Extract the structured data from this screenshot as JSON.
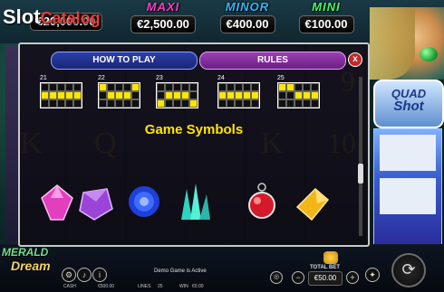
{
  "watermark": {
    "part1": "Slot",
    "part2": "Catalog"
  },
  "jackpots": [
    {
      "name": "",
      "amount": "€20,000.00",
      "color": "#ffffff"
    },
    {
      "name": "MAXI",
      "amount": "€2,500.00",
      "color": "#ff3cc8"
    },
    {
      "name": "MINOR",
      "amount": "€400.00",
      "color": "#35b7ff"
    },
    {
      "name": "MINI",
      "amount": "€100.00",
      "color": "#3cff6a"
    }
  ],
  "panel": {
    "tab_howto": "HOW TO PLAY",
    "tab_rules": "RULES",
    "close_label": "x",
    "heading": "Game Symbols",
    "lines": [
      {
        "num": "21",
        "cells": [
          0,
          0,
          0,
          0,
          0,
          1,
          1,
          1,
          1,
          1,
          0,
          0,
          0,
          0,
          0
        ]
      },
      {
        "num": "22",
        "cells": [
          1,
          0,
          0,
          0,
          1,
          0,
          1,
          1,
          1,
          0,
          0,
          0,
          0,
          0,
          0
        ]
      },
      {
        "num": "23",
        "cells": [
          0,
          0,
          0,
          0,
          0,
          0,
          1,
          1,
          1,
          0,
          1,
          0,
          0,
          0,
          1
        ]
      },
      {
        "num": "24",
        "cells": [
          0,
          0,
          0,
          0,
          0,
          1,
          1,
          1,
          1,
          1,
          0,
          0,
          0,
          0,
          0
        ]
      },
      {
        "num": "25",
        "cells": [
          1,
          1,
          0,
          0,
          0,
          0,
          0,
          1,
          1,
          1,
          0,
          0,
          0,
          0,
          0
        ]
      }
    ]
  },
  "reels": {
    "letters": [
      "K",
      "Q",
      "K",
      "10"
    ],
    "right_number": "9"
  },
  "branding": {
    "logo_line1": "MERALD",
    "logo_line2": "Dream",
    "quad_line1": "QUAD",
    "quad_line2": "Shot"
  },
  "status": {
    "cash_label": "CASH",
    "cash_value": "€500.00",
    "lines_label": "LINES",
    "lines_value": "25",
    "win_label": "WIN",
    "win_value": "€0.00",
    "demo_text": "Demo Game is Active",
    "total_bet_label": "TOTAL BET",
    "total_bet_value": "€50.00"
  },
  "colors": {
    "accent_yellow": "#ffe600",
    "tab_blue": "#2b3fa8",
    "tab_purple": "#9b3fb4"
  }
}
